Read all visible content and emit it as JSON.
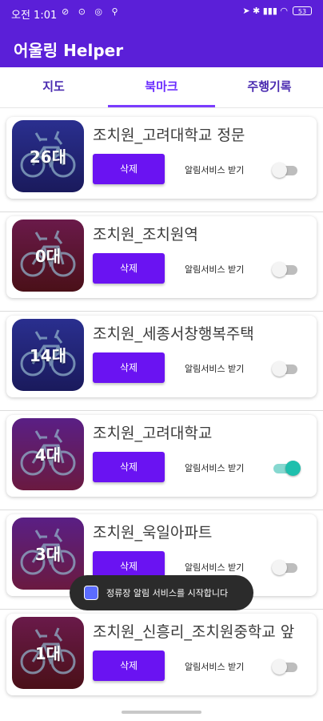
{
  "status_bar": {
    "time": "오전 1:01",
    "left_icons": [
      "sync-off-icon",
      "power-icon",
      "location-icon",
      "bike-icon"
    ],
    "left_glyphs": "⊘ ⊙ ◎ ⚲",
    "right_glyphs": "➤ ✱ ▮▮▮ ◠",
    "battery": "53"
  },
  "app": {
    "title": "어울링 Helper"
  },
  "tabs": [
    {
      "label": "지도"
    },
    {
      "label": "북마크",
      "selected": true
    },
    {
      "label": "주행기록"
    }
  ],
  "items": [
    {
      "station": "조치원_고려대학교 정문",
      "count": "26대",
      "button": "삭제",
      "notify_label": "알림서비스 받기",
      "enabled": false,
      "colors": [
        "#2a2f8f",
        "#1a1a5c"
      ]
    },
    {
      "station": "조치원_조치원역",
      "count": "0대",
      "button": "삭제",
      "notify_label": "알림서비스 받기",
      "enabled": false,
      "colors": [
        "#6a1a4a",
        "#4a1018"
      ]
    },
    {
      "station": "조치원_세종서창행복주택",
      "count": "14대",
      "button": "삭제",
      "notify_label": "알림서비스 받기",
      "enabled": false,
      "colors": [
        "#2a2f8f",
        "#1a1a5c"
      ]
    },
    {
      "station": "조치원_고려대학교",
      "count": "4대",
      "button": "삭제",
      "notify_label": "알림서비스 받기",
      "enabled": true,
      "colors": [
        "#5a1f85",
        "#6a1a40"
      ]
    },
    {
      "station": "조치원_욱일아파트",
      "count": "3대",
      "button": "삭제",
      "notify_label": "알림서비스 받기",
      "enabled": false,
      "colors": [
        "#5a1f85",
        "#6a1a40"
      ]
    },
    {
      "station": "조치원_신흥리_조치원중학교 앞",
      "count": "1대",
      "button": "삭제",
      "notify_label": "알림서비스 받기",
      "enabled": false,
      "colors": [
        "#6a1a4a",
        "#4a1018"
      ]
    }
  ],
  "toast": {
    "text": "정류장 알림 서비스를 시작합니다",
    "icon": "app-icon"
  }
}
